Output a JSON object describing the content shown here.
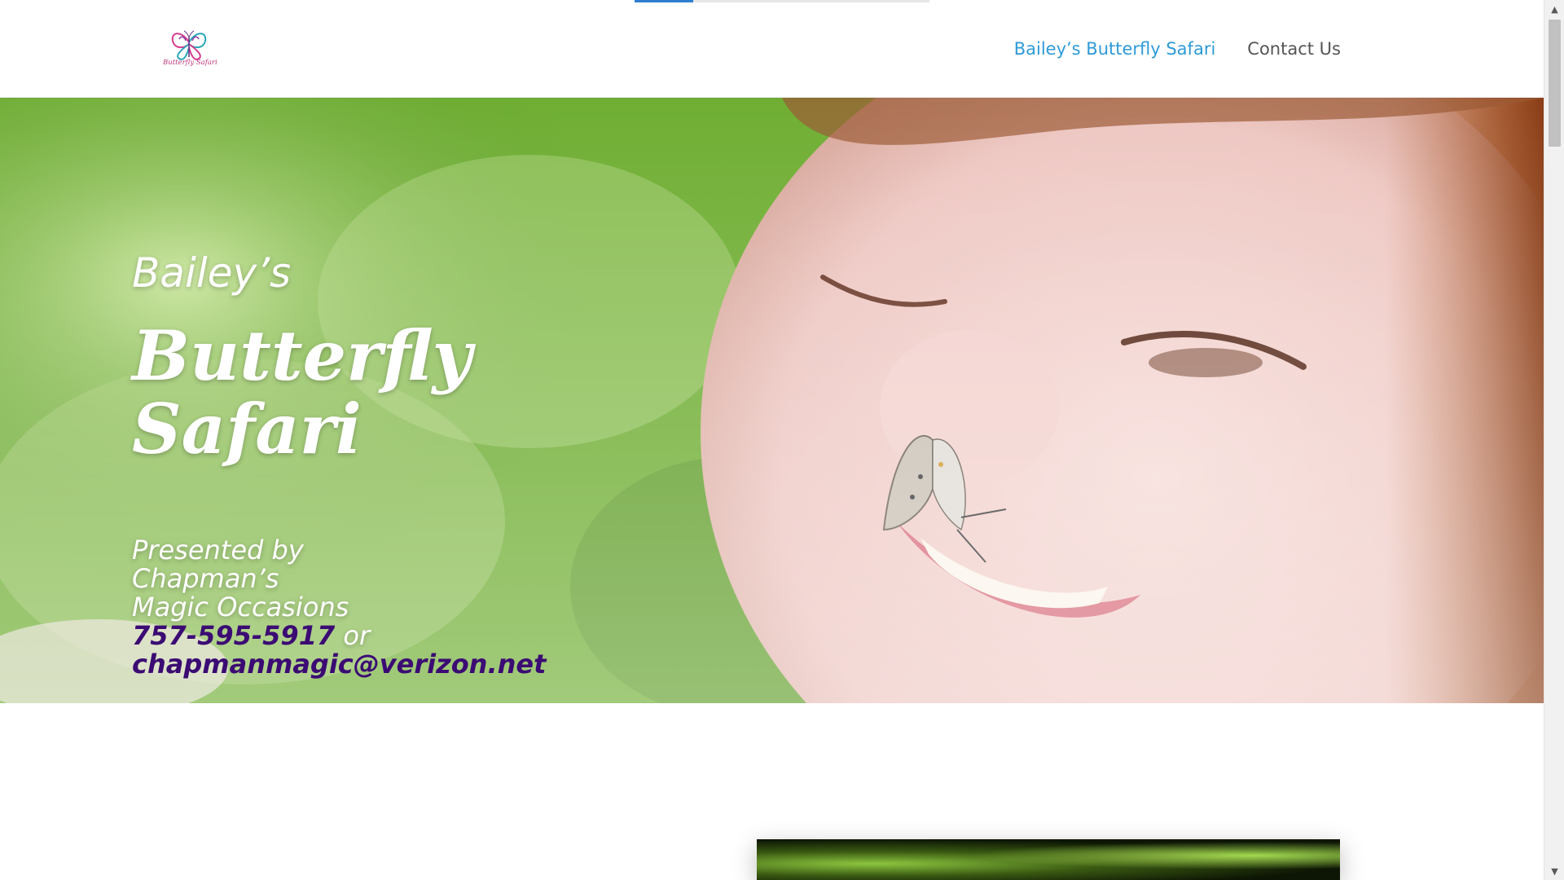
{
  "header": {
    "logo_alt": "Butterfly Safari",
    "logo_text": "Butterfly Safari",
    "nav": [
      {
        "label": "Bailey’s Butterfly Safari",
        "active": true
      },
      {
        "label": "Contact Us",
        "active": false
      }
    ]
  },
  "hero": {
    "kicker": "Bailey’s",
    "title": "Butterfly Safari",
    "presented_lines": [
      "Presented by",
      "Chapman’s",
      "Magic Occasions"
    ],
    "phone": "757-595-5917",
    "or_text": "or",
    "email": "chapmanmagic@verizon.net"
  },
  "colors": {
    "accent": "#2e9ad9",
    "nav_text": "#555555",
    "contact_text": "#3b0b73",
    "loader": "#2e7fd1"
  },
  "icons": {
    "scroll_up": "▲",
    "scroll_down": "▼"
  }
}
